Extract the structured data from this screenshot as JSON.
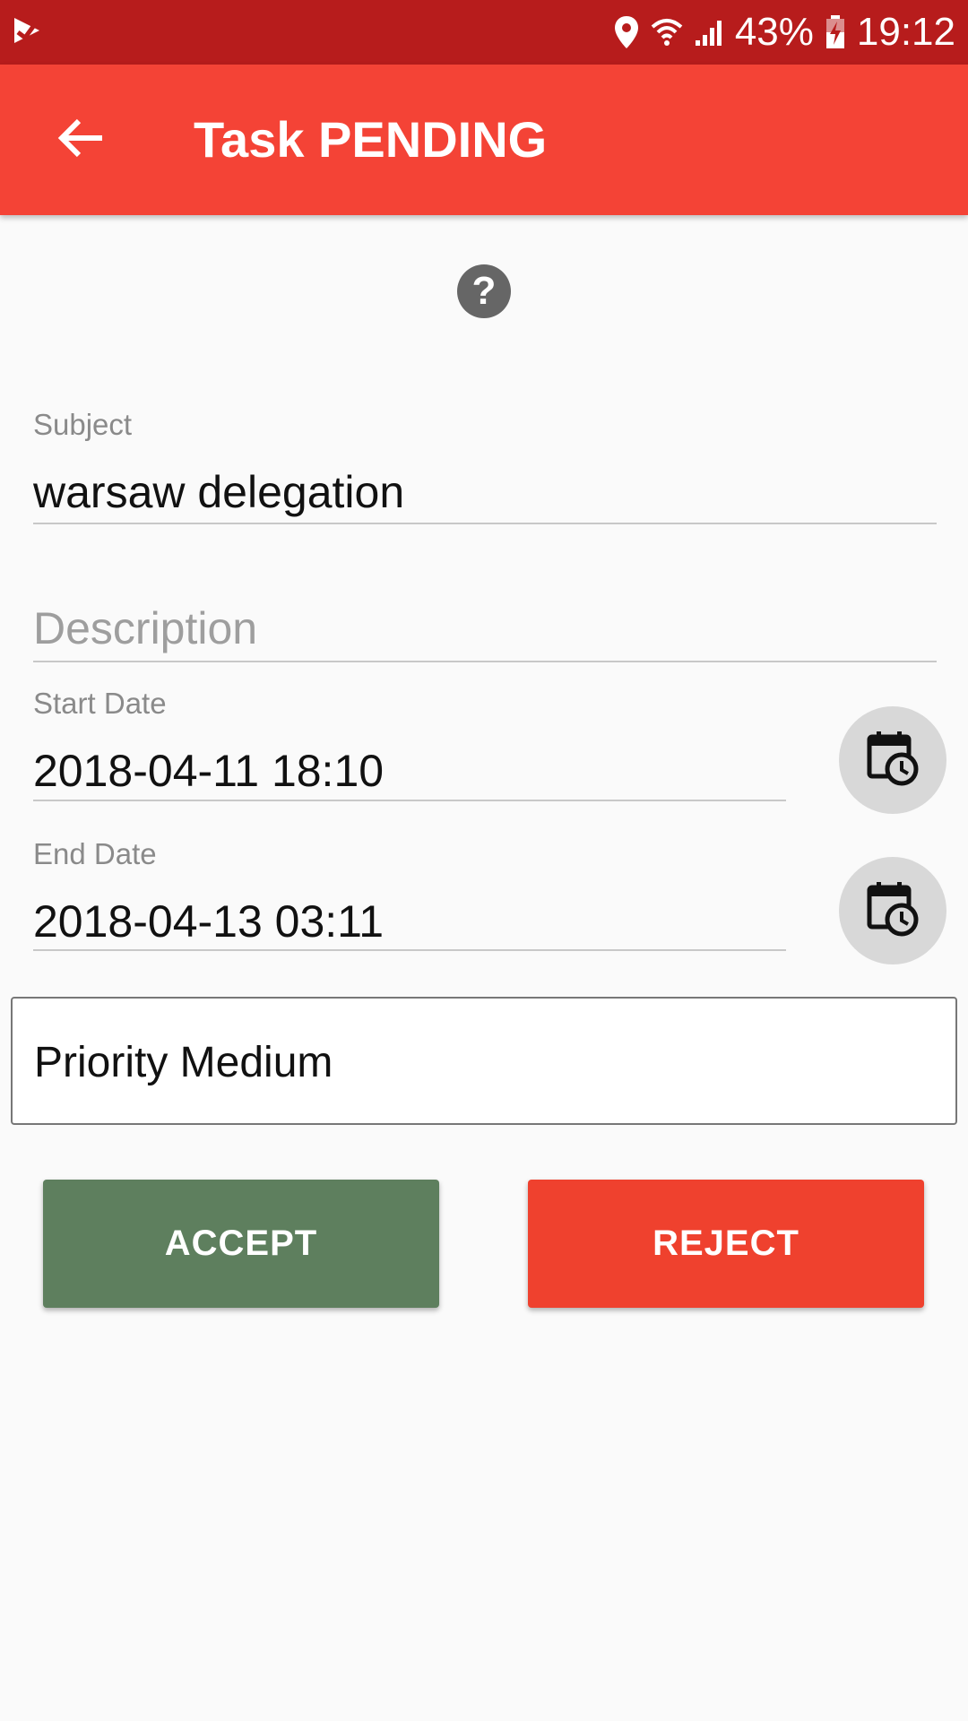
{
  "status_bar": {
    "battery": "43%",
    "time": "19:12",
    "icons": [
      "check-notification-icon",
      "location-icon",
      "wifi-icon",
      "signal-icon",
      "battery-charging-icon"
    ]
  },
  "app_bar": {
    "title": "Task PENDING",
    "back_icon": "arrow-back-icon",
    "color": "#f44336"
  },
  "form": {
    "help_icon": "?",
    "subject": {
      "label": "Subject",
      "value": "warsaw delegation"
    },
    "description": {
      "placeholder": "Description"
    },
    "start_date": {
      "label": "Start Date",
      "value": "2018-04-11 18:10"
    },
    "end_date": {
      "label": "End Date",
      "value": "2018-04-13 03:11"
    },
    "priority": {
      "value": "Priority Medium"
    }
  },
  "actions": {
    "accept_label": "ACCEPT",
    "reject_label": "REJECT",
    "accept_color": "#5e7f5e",
    "reject_color": "#ef412e"
  }
}
